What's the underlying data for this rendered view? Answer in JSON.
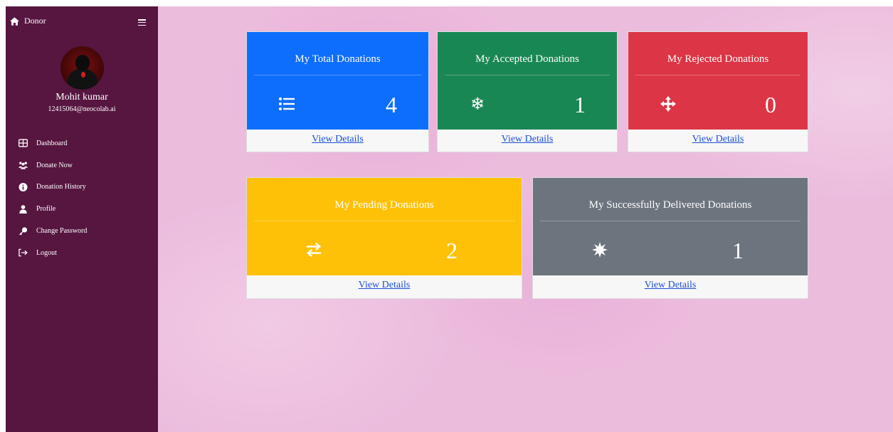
{
  "sidebar": {
    "brand": "Donor",
    "user_name": "Mohit kumar",
    "user_email": "12415064@neocolab.ai",
    "items": [
      {
        "label": "Dashboard",
        "icon": "dashboard-icon"
      },
      {
        "label": "Donate Now",
        "icon": "users-icon"
      },
      {
        "label": "Donation History",
        "icon": "info-icon"
      },
      {
        "label": "Profile",
        "icon": "user-icon"
      },
      {
        "label": "Change Password",
        "icon": "key-icon"
      },
      {
        "label": "Logout",
        "icon": "logout-icon"
      }
    ]
  },
  "cards": [
    {
      "title": "My Total Donations",
      "count": "4",
      "link": "View Details",
      "color": "#0d6efd",
      "icon": "list-icon"
    },
    {
      "title": "My Accepted Donations",
      "count": "1",
      "link": "View Details",
      "color": "#198754",
      "icon": "snowflake-icon"
    },
    {
      "title": "My Rejected Donations",
      "count": "0",
      "link": "View Details",
      "color": "#dc3545",
      "icon": "move-arrows-icon"
    },
    {
      "title": "My Pending Donations",
      "count": "2",
      "link": "View Details",
      "color": "#ffc107",
      "icon": "exchange-icon"
    },
    {
      "title": "My Successfully Delivered Donations",
      "count": "1",
      "link": "View Details",
      "color": "#6c757d",
      "icon": "burst-icon"
    }
  ],
  "colors": {
    "sidebar_bg": "#561640",
    "link": "#1a4fd6"
  }
}
